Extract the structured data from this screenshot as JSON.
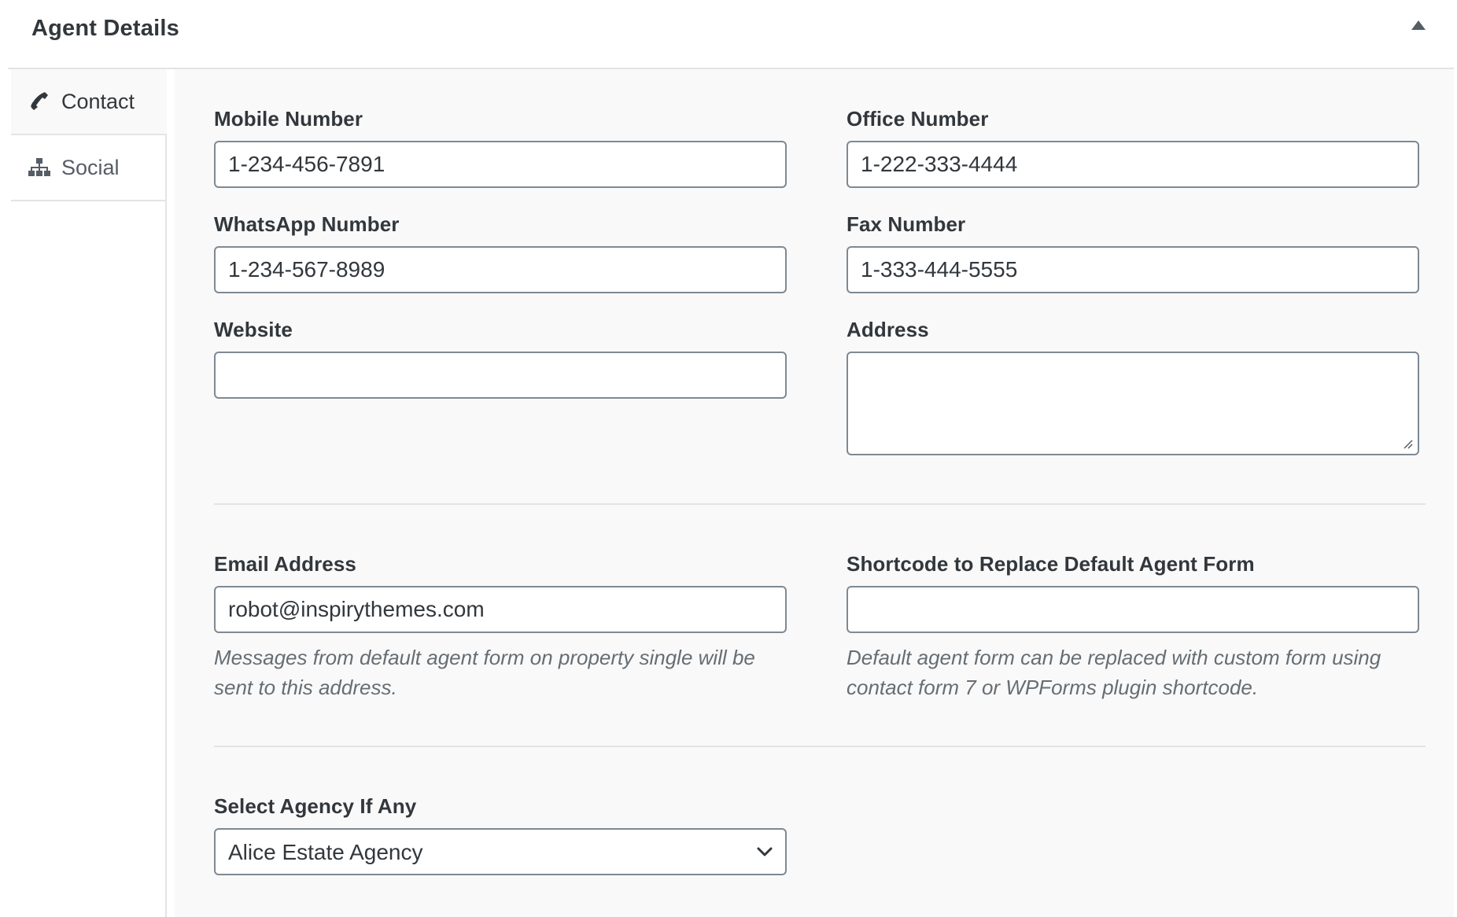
{
  "metabox": {
    "title": "Agent Details",
    "toggle_icon": "triangle-up-icon"
  },
  "tabs": [
    {
      "label": "Contact",
      "icon": "phone-icon",
      "active": true
    },
    {
      "label": "Social",
      "icon": "sitemap-icon",
      "active": false
    }
  ],
  "fields": {
    "mobile": {
      "label": "Mobile Number",
      "value": "1-234-456-7891"
    },
    "office": {
      "label": "Office Number",
      "value": "1-222-333-4444"
    },
    "whatsapp": {
      "label": "WhatsApp Number",
      "value": "1-234-567-8989"
    },
    "fax": {
      "label": "Fax Number",
      "value": "1-333-444-5555"
    },
    "website": {
      "label": "Website",
      "value": ""
    },
    "address": {
      "label": "Address",
      "value": ""
    },
    "email": {
      "label": "Email Address",
      "value": "robot@inspirythemes.com",
      "description": "Messages from default agent form on property single will be sent to this address."
    },
    "shortcode": {
      "label": "Shortcode to Replace Default Agent Form",
      "value": "",
      "description": "Default agent form can be replaced with custom form using contact form 7 or WPForms plugin shortcode."
    },
    "agency": {
      "label": "Select Agency If Any",
      "selected": "Alice Estate Agency",
      "icon": "chevron-down-icon"
    }
  },
  "colors": {
    "label": "#32373c",
    "border": "#7e8993",
    "panel_bg": "#f9f9f9",
    "divider": "#e2e4e7",
    "description": "#666d73"
  }
}
